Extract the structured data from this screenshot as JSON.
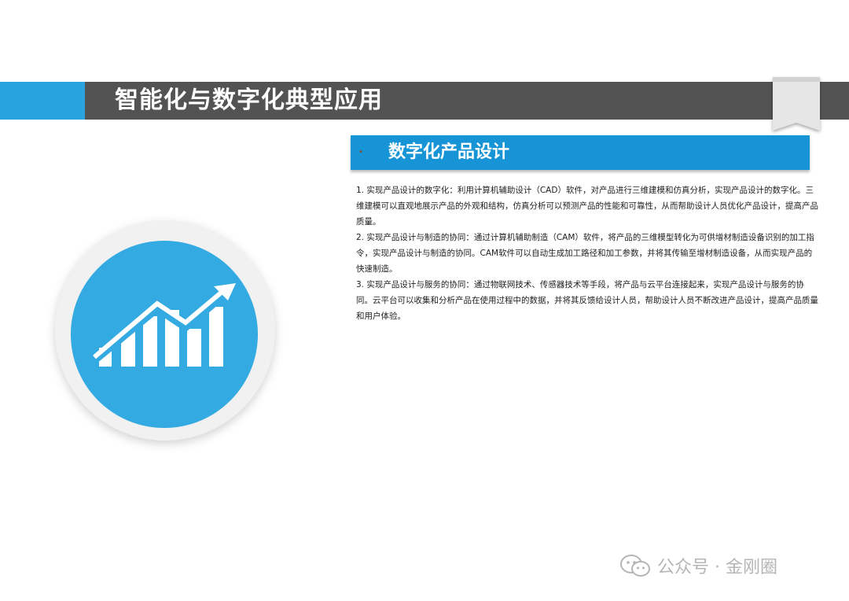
{
  "header": {
    "title": "智能化与数字化典型应用"
  },
  "section": {
    "bullet": "•",
    "title": "数字化产品设计"
  },
  "paragraphs": [
    "1. 实现产品设计的数字化：利用计算机辅助设计（CAD）软件，对产品进行三维建模和仿真分析，实现产品设计的数字化。三维建模可以直观地展示产品的外观和结构，仿真分析可以预测产品的性能和可靠性，从而帮助设计人员优化产品设计，提高产品质量。",
    "2. 实现产品设计与制造的协同：通过计算机辅助制造（CAM）软件，将产品的三维模型转化为可供增材制造设备识别的加工指令，实现产品设计与制造的协同。CAM软件可以自动生成加工路径和加工参数，并将其传输至增材制造设备，从而实现产品的快速制造。",
    "3. 实现产品设计与服务的协同：通过物联网技术、传感器技术等手段，将产品与云平台连接起来，实现产品设计与服务的协同。云平台可以收集和分析产品在使用过程中的数据，并将其反馈给设计人员，帮助设计人员不断改进产品设计，提高产品质量和用户体验。"
  ],
  "watermark": {
    "text": "公众号 · 金刚圈"
  },
  "icons": {
    "chart": "growth-chart-icon",
    "bookmark": "bookmark-icon",
    "watermark": "wechat-icon"
  },
  "colors": {
    "title_bar": "#535353",
    "accent_blue": "#29a3e0",
    "section_blue": "#1694d6",
    "circle_blue": "#33aae2"
  }
}
